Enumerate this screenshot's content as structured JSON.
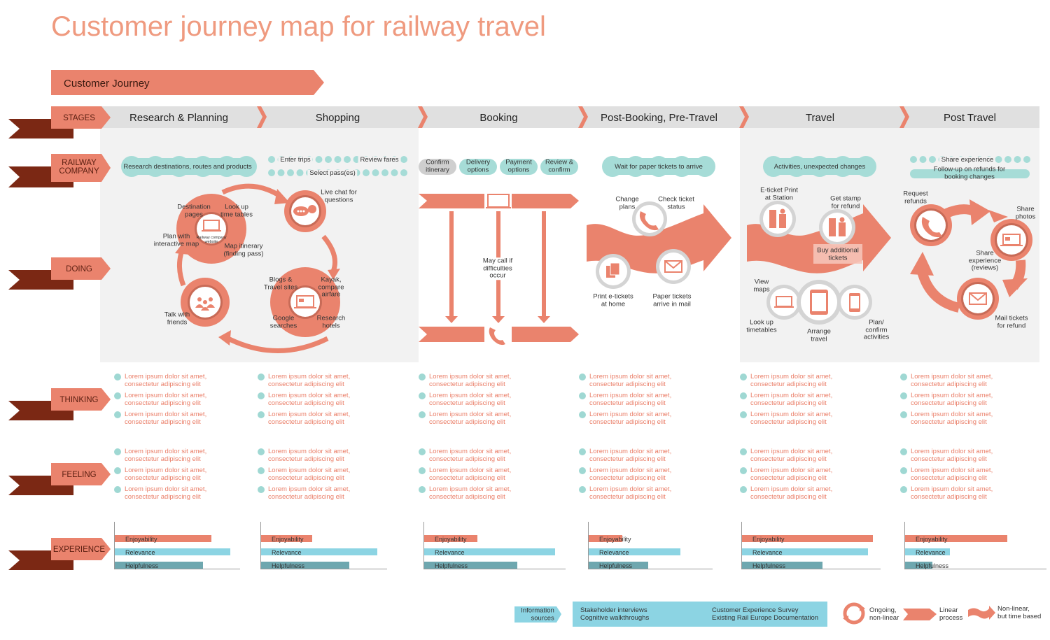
{
  "title": "Customer journey map for railway travel",
  "journey_label": "Customer Journey",
  "row_labels": {
    "stages": "STAGES",
    "railway_company": "RAILWAY\nCOMPANY",
    "doing": "DOING",
    "thinking": "THINKING",
    "feeling": "FEELING",
    "experience": "EXPERIENCE"
  },
  "stages": [
    "Research & Planning",
    "Shopping",
    "Booking",
    "Post-Booking, Pre-Travel",
    "Travel",
    "Post Travel"
  ],
  "railway": {
    "research": "Research destinations, routes and products",
    "shopping": {
      "enter_trips": "Enter trips",
      "review_fares": "Review fares",
      "select_passes": "Select pass(es)"
    },
    "booking": [
      "Confirm\nitinerary",
      "Delivery\noptions",
      "Payment\noptions",
      "Review &\nconfirm"
    ],
    "post_booking": "Wait for paper tickets to arrive",
    "travel": "Activities, unexpected changes",
    "post_travel": {
      "share": "Share experience",
      "followup": "Follow-up on refunds for booking changes"
    }
  },
  "doing": {
    "research": {
      "destination": "Destination\npages",
      "timetables": "Look up\ntime tables",
      "website": "Railway company\nwebsite",
      "plan_map": "Plan with\ninteractive map",
      "map_itinerary": "Map itinerary\n(finding pass)",
      "live_chat": "Live chat for\nquestions",
      "blogs": "Blogs &\nTravel sites",
      "kayak": "Kayak,\ncompare\nairfare",
      "google": "Google\nsearches",
      "hotels": "Research\nhotels",
      "friends": "Talk with\nfriends"
    },
    "booking": {
      "call": "May call if\ndifficulties\noccur"
    },
    "post_booking": {
      "change": "Change\nplans",
      "check": "Check ticket\nstatus",
      "print": "Print e-tickets\nat home",
      "paper": "Paper tickets\narrive in mail"
    },
    "travel": {
      "eticket": "E-ticket Print\nat Station",
      "stamp": "Get stamp\nfor refund",
      "buy": "Buy additional\ntickets",
      "maps": "View\nmaps",
      "timetables": "Look up\ntimetables",
      "arrange": "Arrange\ntravel",
      "plan": "Plan/\nconfirm\nactivities"
    },
    "post_travel": {
      "refunds": "Request\nrefunds",
      "photos": "Share\nphotos",
      "reviews": "Share\nexperience\n(reviews)",
      "mail": "Mail tickets\nfor refund"
    }
  },
  "thinking": [
    [
      "Lorem ipsum dolor sit amet,\nconsectetur adipiscing elit",
      "Lorem ipsum dolor sit amet,\nconsectetur adipiscing elit",
      "Lorem ipsum dolor sit amet,\nconsectetur adipiscing elit"
    ],
    [
      "Lorem ipsum dolor sit amet,\nconsectetur adipiscing elit",
      "Lorem ipsum dolor sit amet,\nconsectetur adipiscing elit",
      "Lorem ipsum dolor sit amet,\nconsectetur adipiscing elit"
    ],
    [
      "Lorem ipsum dolor sit amet,\nconsectetur adipiscing elit",
      "Lorem ipsum dolor sit amet,\nconsectetur adipiscing elit",
      "Lorem ipsum dolor sit amet,\nconsectetur adipiscing elit"
    ],
    [
      "Lorem ipsum dolor sit amet,\nconsectetur adipiscing elit",
      "Lorem ipsum dolor sit amet,\nconsectetur adipiscing elit",
      "Lorem ipsum dolor sit amet,\nconsectetur adipiscing elit"
    ],
    [
      "Lorem ipsum dolor sit amet,\nconsectetur adipiscing elit",
      "Lorem ipsum dolor sit amet,\nconsectetur adipiscing elit",
      "Lorem ipsum dolor sit amet,\nconsectetur adipiscing elit"
    ],
    [
      "Lorem ipsum dolor sit amet,\nconsectetur adipiscing elit",
      "Lorem ipsum dolor sit amet,\nconsectetur adipiscing elit",
      "Lorem ipsum dolor sit amet,\nconsectetur adipiscing elit"
    ]
  ],
  "feeling": [
    [
      "Lorem ipsum dolor sit amet,\nconsectetur adipiscing elit",
      "Lorem ipsum dolor sit amet,\nconsectetur adipiscing elit",
      "Lorem ipsum dolor sit amet,\nconsectetur adipiscing elit"
    ],
    [
      "Lorem ipsum dolor sit amet,\nconsectetur adipiscing elit",
      "Lorem ipsum dolor sit amet,\nconsectetur adipiscing elit",
      "Lorem ipsum dolor sit amet,\nconsectetur adipiscing elit"
    ],
    [
      "Lorem ipsum dolor sit amet,\nconsectetur adipiscing elit",
      "Lorem ipsum dolor sit amet,\nconsectetur adipiscing elit",
      "Lorem ipsum dolor sit amet,\nconsectetur adipiscing elit"
    ],
    [
      "Lorem ipsum dolor sit amet,\nconsectetur adipiscing elit",
      "Lorem ipsum dolor sit amet,\nconsectetur adipiscing elit",
      "Lorem ipsum dolor sit amet,\nconsectetur adipiscing elit"
    ],
    [
      "Lorem ipsum dolor sit amet,\nconsectetur adipiscing elit",
      "Lorem ipsum dolor sit amet,\nconsectetur adipiscing elit",
      "Lorem ipsum dolor sit amet,\nconsectetur adipiscing elit"
    ],
    [
      "Lorem ipsum dolor sit amet,\nconsectetur adipiscing elit",
      "Lorem ipsum dolor sit amet,\nconsectetur adipiscing elit",
      "Lorem ipsum dolor sit amet,\nconsectetur adipiscing elit"
    ]
  ],
  "experience": {
    "metrics": [
      "Enjoyability",
      "Relevance",
      "Helpfulness"
    ],
    "colors": [
      "#ea836d",
      "#8cd4e3",
      "#6ea7af"
    ],
    "values": [
      [
        0.8,
        0.96,
        0.73
      ],
      [
        0.42,
        0.96,
        0.73
      ],
      [
        0.39,
        0.96,
        0.68
      ],
      [
        0.28,
        0.77,
        0.5
      ],
      [
        0.98,
        0.94,
        0.6
      ],
      [
        0.75,
        0.33,
        0.2
      ]
    ]
  },
  "legend": {
    "info_label": "Information\nsources",
    "sources_left": "Stakeholder interviews\nCognitive walkthroughs",
    "sources_right": "Customer Experience Survey\nExisting Rail Europe Documentation",
    "ongoing": "Ongoing,\nnon-linear",
    "linear": "Linear\nprocess",
    "nonlinear": "Non-linear,\nbut time based"
  },
  "colors": {
    "accent": "#ea836d",
    "dark_ribbon": "#7b2814",
    "pill": "#a6dcd7",
    "header": "#e0e0e0",
    "panel": "#f2f2f2"
  }
}
